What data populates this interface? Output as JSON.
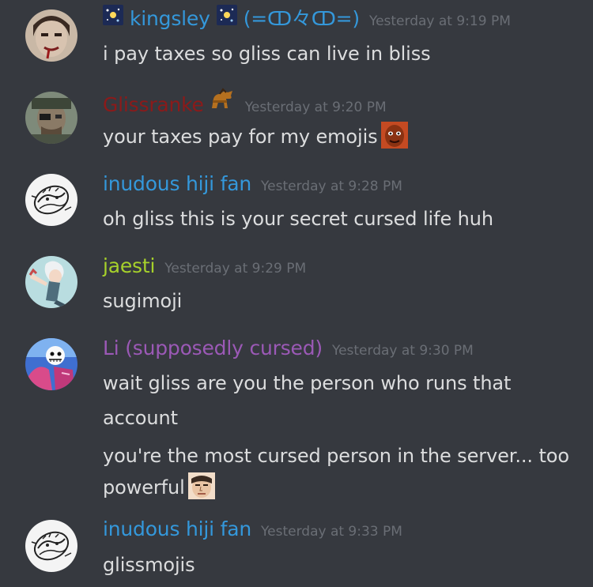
{
  "colors": {
    "background": "#36393f",
    "message_text": "#dcddde",
    "timestamp": "#6a6e75",
    "kingsley": "#3498db",
    "glissranke": "#8b1a1a",
    "inudous": "#3498db",
    "jaesti": "#a6d12b",
    "li": "#9b59b6"
  },
  "messages": [
    {
      "author": "kingsley",
      "author_suffix": "(=ↀ々ↀ=)",
      "timestamp": "Yesterday at 9:19 PM",
      "lines": [
        "i pay taxes so gliss can live in bliss"
      ]
    },
    {
      "author": "Glissranke",
      "timestamp": "Yesterday at 9:20 PM",
      "lines": [
        "your taxes pay for my emojis"
      ]
    },
    {
      "author": "inudous hiji fan",
      "timestamp": "Yesterday at 9:28 PM",
      "lines": [
        "oh gliss this is your secret cursed life huh"
      ]
    },
    {
      "author": "jaesti",
      "timestamp": "Yesterday at 9:29 PM",
      "lines": [
        "sugimoji"
      ]
    },
    {
      "author": "Li (supposedly cursed)",
      "timestamp": "Yesterday at 9:30 PM",
      "lines": [
        "wait gliss are you the person who runs that",
        "account",
        "you're the most cursed person in the server... too",
        "powerful"
      ]
    },
    {
      "author": "inudous hiji fan",
      "timestamp": "Yesterday at 9:33 PM",
      "lines": [
        "glissmojis"
      ]
    }
  ]
}
